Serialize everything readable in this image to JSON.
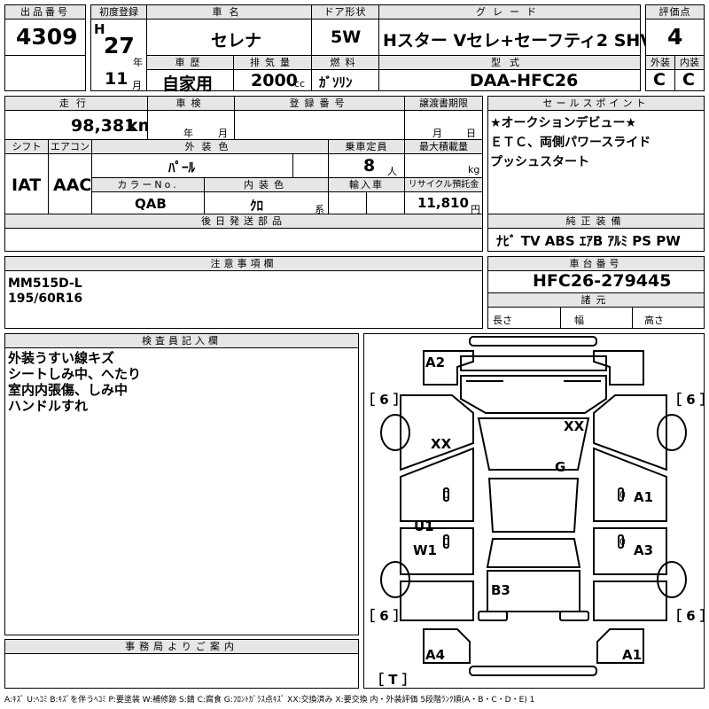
{
  "headers": {
    "lot_no": "出品番号",
    "first_reg": "初度登録",
    "car_name": "車名",
    "door": "ドア形状",
    "grade": "グレード",
    "score": "評価点",
    "history": "車歴",
    "displacement": "排気量",
    "fuel": "燃料",
    "model": "型式",
    "exterior": "外装",
    "interior": "内装",
    "mileage": "走行",
    "inspection": "車検",
    "reg_no": "登録番号",
    "transfer": "譲渡書期限",
    "sales_point": "セールスポイント",
    "shift": "シフト",
    "aircon": "エアコン",
    "ext_color": "外装色",
    "capacity": "乗車定員",
    "max_load": "最大積載量",
    "color_no": "カラーNo.",
    "int_color": "内装色",
    "import": "輸入車",
    "recycle": "リサイクル預託金",
    "later_parts": "後日発送部品",
    "genuine": "純正装備",
    "caution": "注意事項欄",
    "chassis": "車台番号",
    "specs": "諸元",
    "inspector": "検査員記入欄",
    "office": "事務局よりご案内"
  },
  "values": {
    "lot_no": "4309",
    "era": "H",
    "year": "27",
    "month": "11",
    "car_name": "セレナ",
    "door": "5W",
    "grade": "Hスター Vセレ+セーフティ2 SHV",
    "score": "4",
    "history": "自家用",
    "displacement": "2000",
    "fuel": "ｶﾞｿﾘﾝ",
    "model": "DAA-HFC26",
    "exterior": "C",
    "interior": "C",
    "mileage": "98,381",
    "shift": "IAT",
    "aircon": "AAC",
    "ext_color": "ﾊﾟｰﾙ",
    "capacity": "8",
    "color_no": "QAB",
    "int_color": "ｸﾛ",
    "recycle": "11,810",
    "genuine": "ﾅﾋﾞ TV ABS ｴｱB ｱﾙﾐ PS PW",
    "chassis": "HFC26-279445"
  },
  "units": {
    "year": "年",
    "month": "月",
    "cc": "cc",
    "km": "km",
    "persons": "人",
    "kg": "kg",
    "series": "系",
    "yen": "円",
    "insp_year": "年",
    "insp_month": "月",
    "tr_month": "月",
    "tr_day": "日",
    "length": "長さ",
    "width": "幅",
    "height": "高さ"
  },
  "sales_points": [
    "★オークションデビュー★",
    "ＥＴＣ、両側パワースライド",
    "プッシュスタート"
  ],
  "caution_lines": [
    "MM515D-L",
    "195/60R16"
  ],
  "inspector_notes": [
    "外装うすい線キズ",
    "シートしみ中、へたり",
    "室内内張傷、しみ中",
    "ハンドルすれ"
  ],
  "diagram": {
    "tire_tl": "［ 6 ］",
    "tire_tr": "［ 6 ］",
    "tire_bl": "［ 6 ］",
    "tire_br": "［ 6 ］",
    "spare": "［ T ］",
    "marks": {
      "front_left_corner": "A2",
      "hood_right": "XX",
      "fender_left": "XX",
      "windshield": "G",
      "front_door_right": "A1",
      "rear_door_left_1": "U1",
      "rear_door_left_2": "W1",
      "rear_door_right": "A3",
      "roof_rear": "B3",
      "rear_left": "A4",
      "rear_right": "A1"
    },
    "zero_marks": [
      "0",
      "0",
      "0",
      "0"
    ]
  },
  "legend": "A:ｷｽﾞ U:ﾍｺﾐ B:ｷｽﾞを伴うﾍｺﾐ P:要塗装 W:補修跡 S:錆 C:腐食 G:ﾌﾛﾝﾄｶﾞﾗｽ点ｷｽﾞ XX:交換済み X:要交換 内・外装評価 5段階ﾗﾝｸ順(A・B・C・D・E) 1"
}
